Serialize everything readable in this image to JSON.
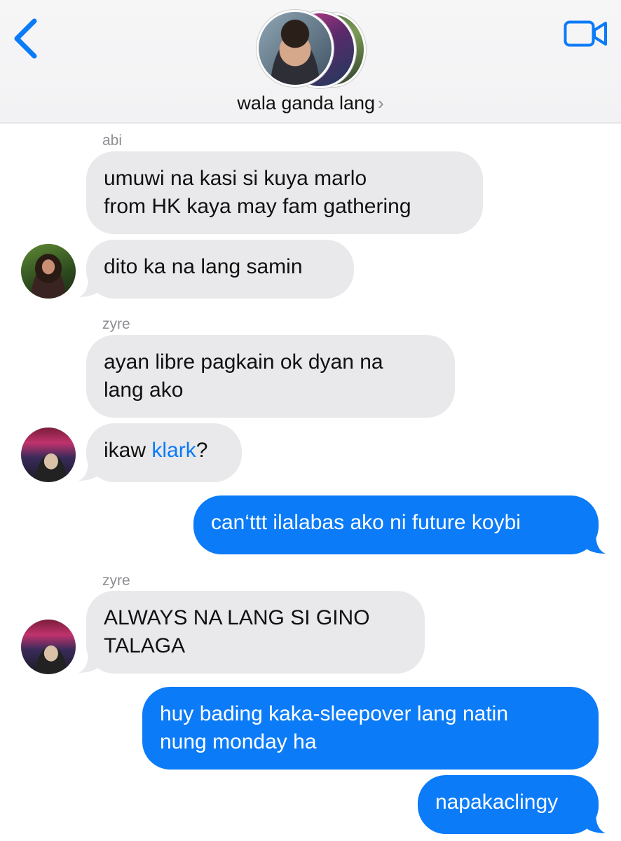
{
  "header": {
    "title": "wala ganda lang",
    "chevron": "›",
    "back_icon": "chevron-left-icon",
    "video_icon": "video-camera-icon",
    "accent_color": "#0b7bf8"
  },
  "messages": [
    {
      "sender": "abi",
      "text_lines": [
        "umuwi na kasi si kuya marlo",
        "from HK kaya may fam gathering"
      ]
    },
    {
      "text": "dito ka na lang samin"
    },
    {
      "sender": "zyre",
      "text_lines": [
        "ayan libre pagkain ok dyan na",
        "lang ako"
      ]
    },
    {
      "text_prefix": "ikaw ",
      "mention": "klark",
      "text_suffix": "?"
    },
    {
      "text": "can‘ttt ilalabas ako ni future koybi"
    },
    {
      "sender": "zyre",
      "text_lines": [
        "ALWAYS NA LANG SI GINO",
        "TALAGA"
      ]
    },
    {
      "text_lines": [
        "huy bading kaka-sleepover lang natin",
        "nung monday ha"
      ]
    },
    {
      "text": "napakaclingy"
    }
  ],
  "colors": {
    "incoming_bubble": "#e9e9eb",
    "outgoing_bubble": "#0b7bf8",
    "sender_label": "#8e8e93"
  }
}
